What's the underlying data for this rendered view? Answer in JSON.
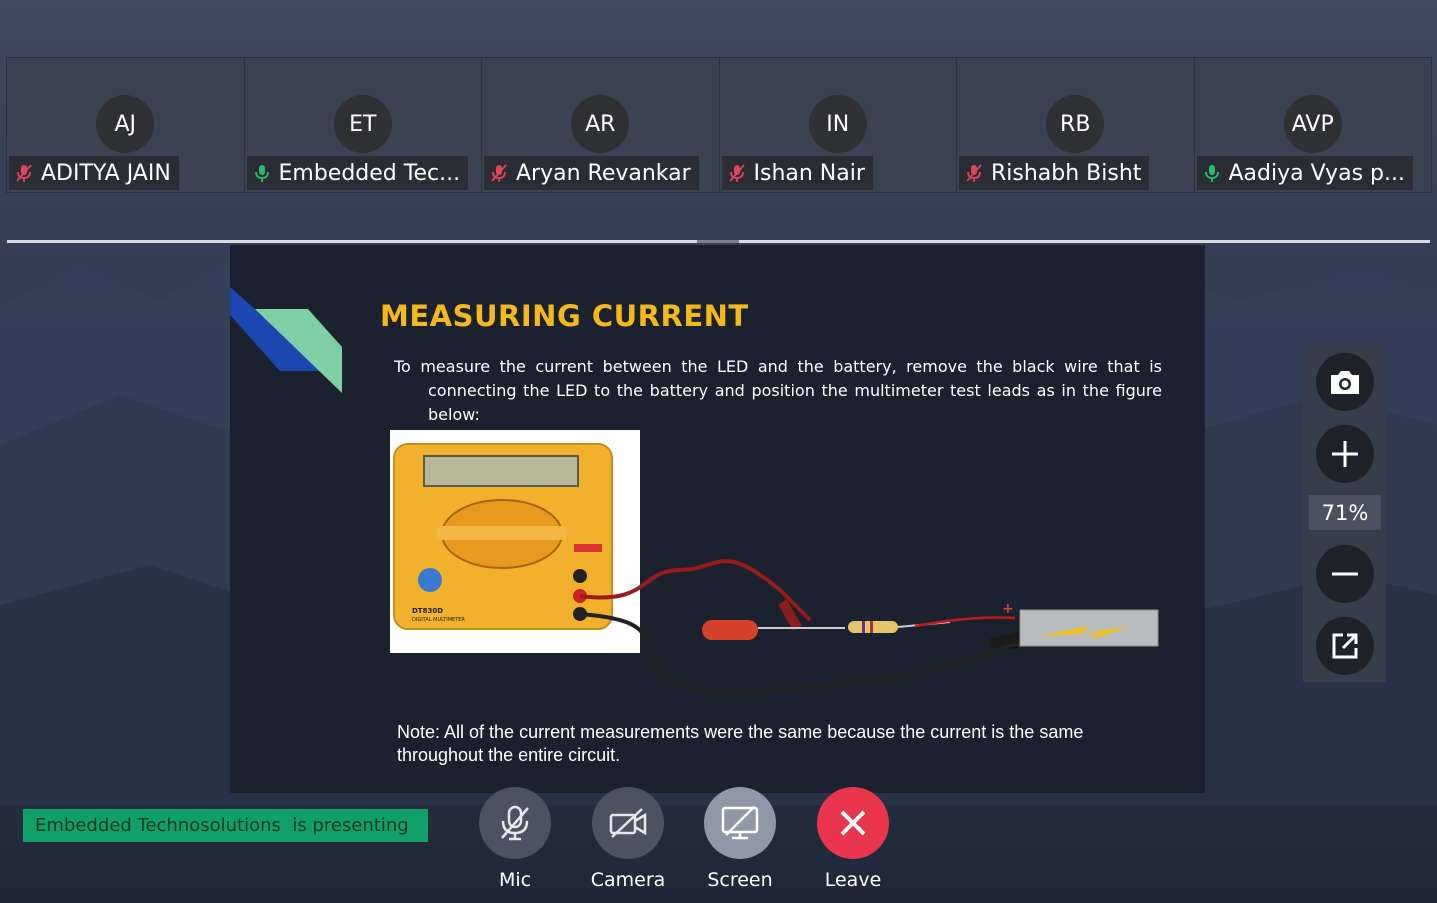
{
  "participants": [
    {
      "initials": "AJ",
      "name": "ADITYA JAIN",
      "mic": "muted"
    },
    {
      "initials": "ET",
      "name": "Embedded Tec...",
      "mic": "on"
    },
    {
      "initials": "AR",
      "name": "Aryan Revankar",
      "mic": "muted"
    },
    {
      "initials": "IN",
      "name": "Ishan Nair",
      "mic": "muted"
    },
    {
      "initials": "RB",
      "name": "Rishabh Bisht",
      "mic": "muted"
    },
    {
      "initials": "AVP",
      "name": "Aadiya Vyas p...",
      "mic": "on"
    }
  ],
  "slide": {
    "title": "MEASURING CURRENT",
    "body": "To measure the current between the LED and the battery, remove the black wire that is connecting the LED to the battery and position the multimeter test leads as in the figure below:",
    "note": "Note: All of the current measurements were the same because the current is the same throughout the entire circuit.",
    "figure": {
      "multimeter_model": "DT830D",
      "multimeter_caption": "DIGITAL MULTIMETER",
      "plus_sign": "+",
      "minus_sign": "−"
    }
  },
  "zoom": {
    "level": "71%"
  },
  "presenting_banner": "Embedded Technosolutions  is presenting",
  "controls": {
    "mic": "Mic",
    "camera": "Camera",
    "screen": "Screen",
    "leave": "Leave"
  },
  "colors": {
    "muted_icon": "#e0455a",
    "mic_on_icon": "#27c06a",
    "title": "#f5b81c",
    "presenting_bg": "#12a06a",
    "leave": "#e8354d"
  }
}
